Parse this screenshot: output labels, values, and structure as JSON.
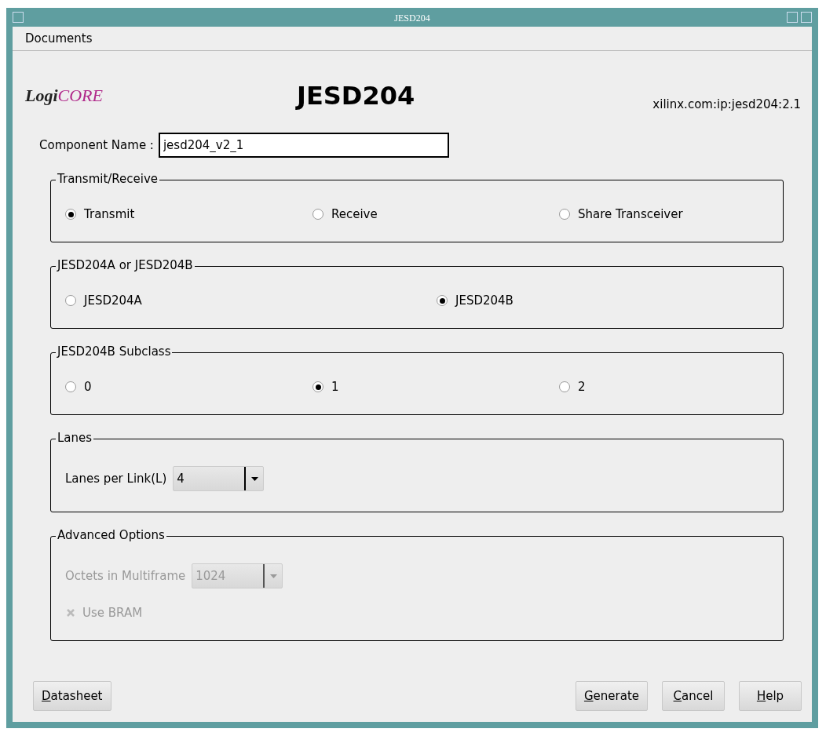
{
  "window": {
    "title": "JESD204"
  },
  "menu": [
    "Documents"
  ],
  "logo": {
    "lead": "Logi",
    "tail": "CORE"
  },
  "heading": "JESD204",
  "ip_id": "xilinx.com:ip:jesd204:2.1",
  "component_name": {
    "label": "Component Name :",
    "value": "jesd204_v2_1"
  },
  "groups": [
    {
      "title": "Transmit/Receive",
      "rows": [
        {
          "kind": "radio",
          "options": [
            {
              "label": "Transmit",
              "selected": true
            },
            {
              "label": "Receive",
              "selected": false
            },
            {
              "label": "Share Transceiver",
              "selected": false
            }
          ]
        }
      ]
    },
    {
      "title": "JESD204A or JESD204B",
      "rows": [
        {
          "kind": "radio",
          "options": [
            {
              "label": "JESD204A",
              "selected": false
            },
            {
              "label": "JESD204B",
              "selected": true
            }
          ]
        }
      ]
    },
    {
      "title": "JESD204B Subclass",
      "rows": [
        {
          "kind": "radio",
          "options": [
            {
              "label": "0",
              "selected": false
            },
            {
              "label": "1",
              "selected": true
            },
            {
              "label": "2",
              "selected": false
            }
          ]
        }
      ]
    },
    {
      "title": "Lanes",
      "rows": [
        {
          "kind": "select",
          "label": "Lanes per Link(L)",
          "value": "4",
          "disabled": false
        }
      ]
    },
    {
      "title": "Advanced Options",
      "rows": [
        {
          "kind": "select",
          "label": "Octets in Multiframe",
          "value": "1024",
          "disabled": true
        },
        {
          "kind": "checkbox",
          "label": "Use BRAM",
          "checked": true,
          "disabled": true
        }
      ]
    }
  ],
  "buttons": [
    {
      "label": "Datasheet"
    },
    {
      "label": "Generate"
    },
    {
      "label": "Cancel"
    },
    {
      "label": "Help"
    }
  ]
}
